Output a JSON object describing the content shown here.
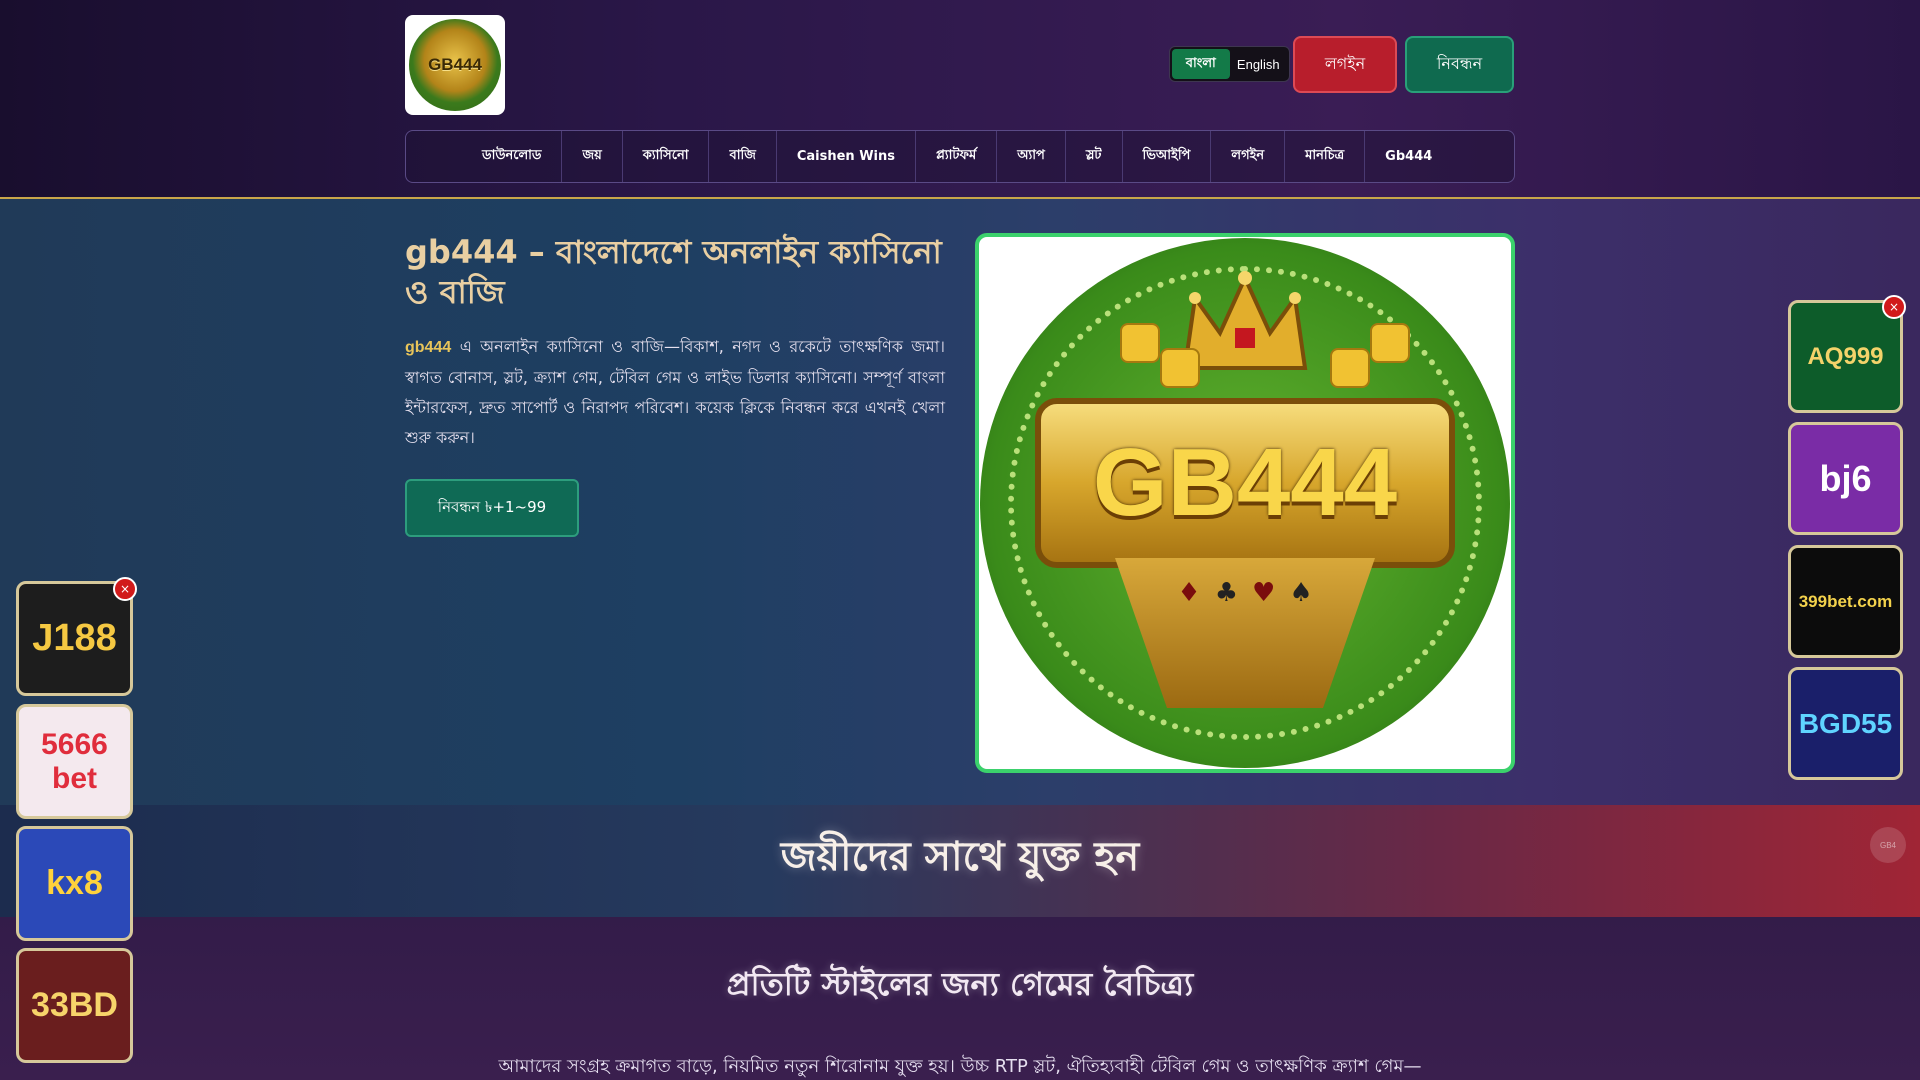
{
  "header": {
    "logo_text": "GB444",
    "languages": [
      "বাংলা",
      "English"
    ],
    "active_language": "বাংলা",
    "login_label": "লগইন",
    "register_label": "নিবন্ধন",
    "nav": [
      "ডাউনলোড",
      "জয়",
      "ক্যাসিনো",
      "বাজি",
      "Caishen Wins",
      "প্ল্যাটফর্ম",
      "অ্যাপ",
      "স্লট",
      "ভিআইপি",
      "লগইন",
      "মানচিত্র",
      "Gb444"
    ]
  },
  "hero": {
    "title": "gb444 – বাংলাদেশে অনলাইন ক্যাসিনো ও বাজি",
    "text_brand": "gb444",
    "text_body": " এ অনলাইন ক্যাসিনো ও বাজি—বিকাশ, নগদ ও রকেটে তাৎক্ষণিক জমা। স্বাগত বোনাস, স্লট, ক্র্যাশ গেম, টেবিল গেম ও লাইভ ডিলার ক্যাসিনো। সম্পূর্ণ বাংলা ইন্টারফেস, দ্রুত সাপোর্ট ও নিরাপদ পরিবেশ। কয়েক ক্লিকে নিবন্ধন করে এখনই খেলা শুরু করুন।",
    "cta_label": "নিবন্ধন ৳+1~99",
    "image_text": "GB444"
  },
  "banner": {
    "title": "জয়ীদের সাথে যুক্ত হন"
  },
  "section": {
    "title": "প্রতিটি স্টাইলের জন্য গেমের বৈচিত্র্য",
    "text": "আমাদের সংগ্রহ ক্রমাগত বাড়ে, নিয়মিত নতুন শিরোনাম যুক্ত হয়। উচ্চ RTP স্লট, ঐতিহ্যবাহী টেবিল গেম ও তাৎক্ষণিক ক্র্যাশ গেম—"
  },
  "ads_left": [
    {
      "label": "J188",
      "bg": "#1d1d1d",
      "color": "#f5c842"
    },
    {
      "label": "5666 bet",
      "bg": "#f4e9ee",
      "color": "#e02d3c"
    },
    {
      "label": "kx8",
      "bg": "#2b49b8",
      "color": "#ffd23c"
    },
    {
      "label": "33BD",
      "bg": "#6a1e1e",
      "color": "#f7d46a"
    }
  ],
  "ads_right": [
    {
      "label": "AQ999",
      "bg": "#0d5c2a",
      "color": "#f3d36a"
    },
    {
      "label": "bj6",
      "bg": "#7a2ca6",
      "color": "#ffffff"
    },
    {
      "label": "399bet.com",
      "bg": "#0c0c0c",
      "color": "#f3d24c"
    },
    {
      "label": "BGD55",
      "bg": "#1a1f6a",
      "color": "#5fd4ff"
    }
  ],
  "close_label": "×",
  "banner_logo_text": "GB4"
}
